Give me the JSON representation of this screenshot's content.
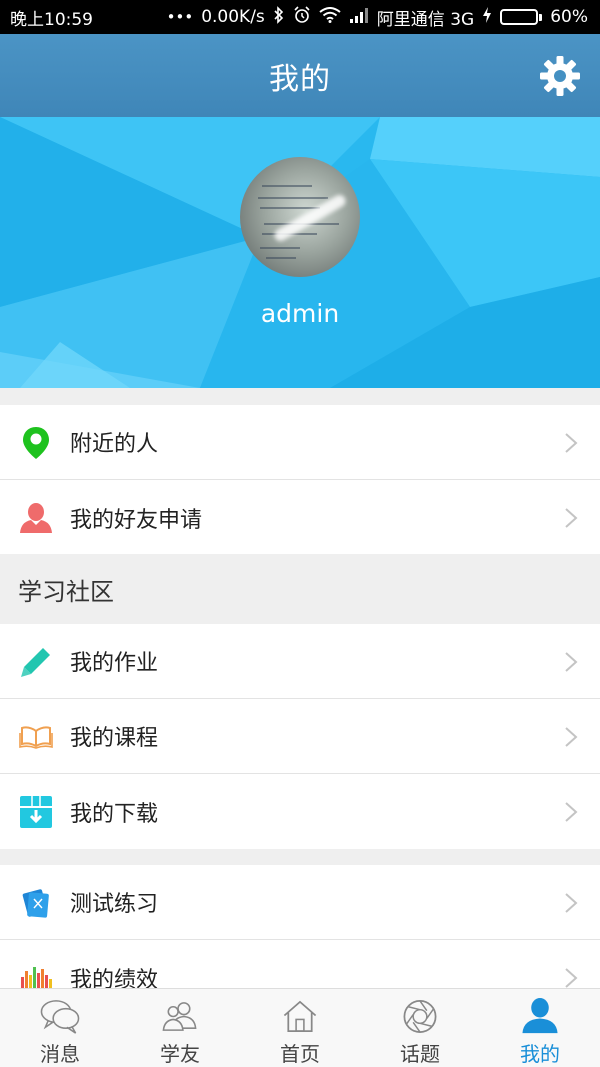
{
  "status_bar": {
    "time": "晚上10:59",
    "network_speed": "0.00K/s",
    "carrier": "阿里通信 3G",
    "battery_percent": "60%",
    "battery_level": 0.6
  },
  "header": {
    "title": "我的",
    "settings_icon": "gear-icon"
  },
  "profile": {
    "username": "admin"
  },
  "group1": [
    {
      "label": "附近的人",
      "icon": "location-pin-icon",
      "color": "#1ec21e"
    },
    {
      "label": "我的好友申请",
      "icon": "person-icon",
      "color": "#ef6b6b"
    }
  ],
  "section": {
    "title": "学习社区"
  },
  "group2": [
    {
      "label": "我的作业",
      "icon": "pencil-icon",
      "color": "#22c6b0"
    },
    {
      "label": "我的课程",
      "icon": "book-icon",
      "color": "#f0a050"
    },
    {
      "label": "我的下载",
      "icon": "download-box-icon",
      "color": "#22c8e0"
    }
  ],
  "group3": [
    {
      "label": "测试练习",
      "icon": "test-cards-icon",
      "color": "#1f86d6"
    },
    {
      "label": "我的绩效",
      "icon": "bar-chart-icon",
      "color": "#e85050"
    }
  ],
  "tabbar": {
    "tabs": [
      {
        "label": "消息",
        "icon": "chat-bubbles-icon"
      },
      {
        "label": "学友",
        "icon": "friends-icon"
      },
      {
        "label": "首页",
        "icon": "home-icon"
      },
      {
        "label": "话题",
        "icon": "aperture-icon"
      },
      {
        "label": "我的",
        "icon": "user-icon"
      }
    ],
    "active_tab": "我的",
    "active_color": "#1a8fd8"
  }
}
